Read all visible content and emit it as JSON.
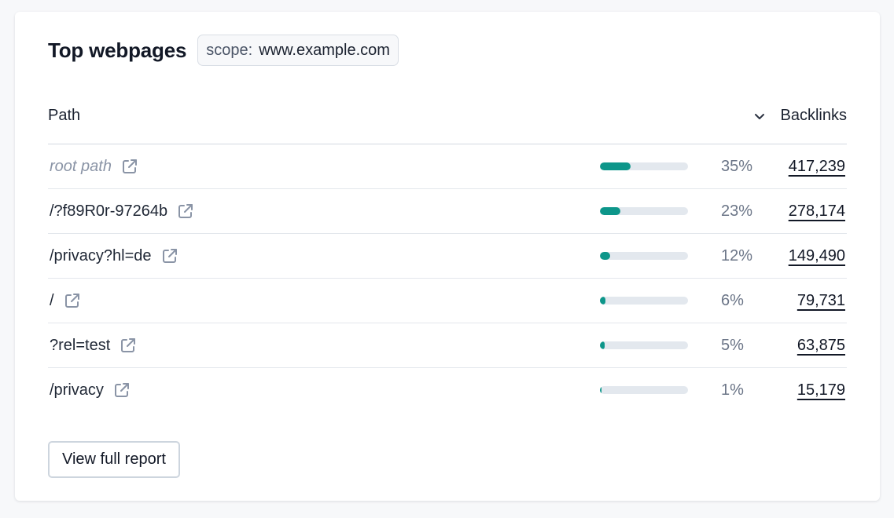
{
  "widget": {
    "title": "Top webpages",
    "scope_label": "scope:",
    "scope_value": "www.example.com"
  },
  "table": {
    "columns": {
      "path": "Path",
      "backlinks": "Backlinks"
    },
    "sort_icon": "chevron-down-icon",
    "rows": [
      {
        "path": "root path",
        "muted": true,
        "share_pct": 35,
        "share_label": "35%",
        "backlinks": "417,239"
      },
      {
        "path": "/?f89R0r-97264b",
        "muted": false,
        "share_pct": 23,
        "share_label": "23%",
        "backlinks": "278,174"
      },
      {
        "path": "/privacy?hl=de",
        "muted": false,
        "share_pct": 12,
        "share_label": "12%",
        "backlinks": "149,490"
      },
      {
        "path": "/",
        "muted": false,
        "share_pct": 6,
        "share_label": "6%",
        "backlinks": "79,731"
      },
      {
        "path": "?rel=test",
        "muted": false,
        "share_pct": 5,
        "share_label": "5%",
        "backlinks": "63,875"
      },
      {
        "path": "/privacy",
        "muted": false,
        "share_pct": 1,
        "share_label": "1%",
        "backlinks": "15,179"
      }
    ]
  },
  "footer": {
    "report_button": "View full report"
  },
  "colors": {
    "bar_fill": "#0d968a",
    "bar_track": "#e3e8ee",
    "muted_text": "#8a94a6"
  }
}
